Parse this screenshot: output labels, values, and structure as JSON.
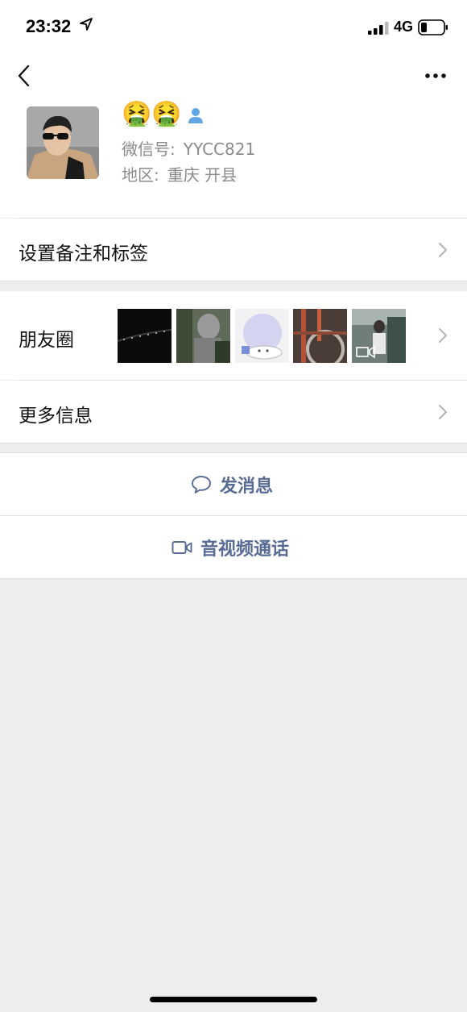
{
  "status_bar": {
    "time": "23:32",
    "network": "4G"
  },
  "nav": {
    "back_icon": "chevron-left-icon",
    "more_icon": "more-dots-icon"
  },
  "profile": {
    "nickname": "🤮🤮",
    "wechat_id_label": "微信号:",
    "wechat_id": "YYCC821",
    "region_label": "地区:",
    "region": "重庆 开县"
  },
  "rows": {
    "remark": "设置备注和标签",
    "moments": "朋友圈",
    "more_info": "更多信息"
  },
  "actions": {
    "message": "发消息",
    "call": "音视频通话"
  },
  "colors": {
    "link": "#576b95",
    "background": "#ededed",
    "secondary_text": "#8a8a8a"
  }
}
